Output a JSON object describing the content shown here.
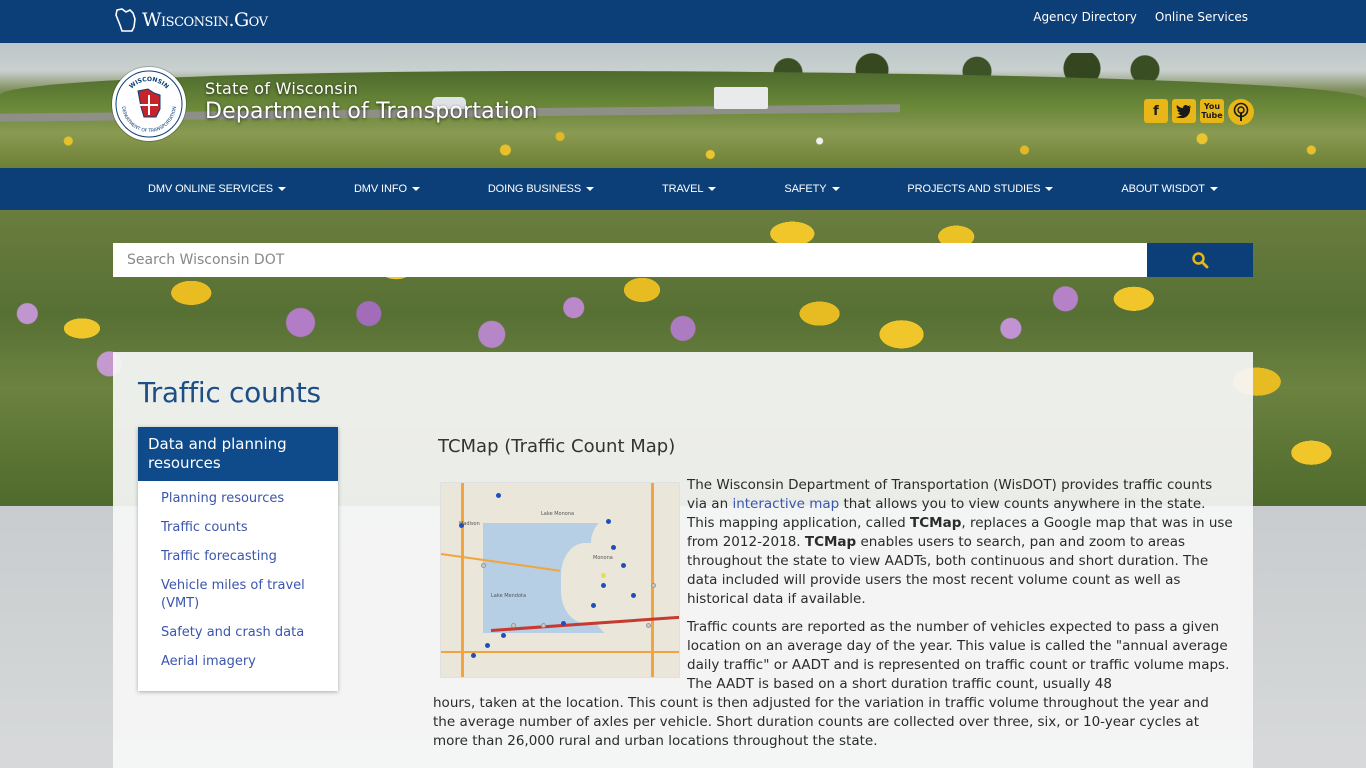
{
  "topbar": {
    "logo_text": "Wisconsin.Gov",
    "links": [
      "Agency Directory",
      "Online Services"
    ]
  },
  "header": {
    "seal_ring_top": "WISCONSIN",
    "seal_ring_bottom": "DEPARTMENT OF TRANSPORTATION",
    "state": "State of Wisconsin",
    "department": "Department of Transportation",
    "social": [
      "facebook-icon",
      "twitter-icon",
      "youtube-icon",
      "podcast-icon"
    ]
  },
  "nav": {
    "items": [
      "DMV ONLINE SERVICES",
      "DMV INFO",
      "DOING BUSINESS",
      "TRAVEL",
      "SAFETY",
      "PROJECTS AND STUDIES",
      "ABOUT WISDOT"
    ]
  },
  "search": {
    "placeholder": "Search Wisconsin DOT"
  },
  "main": {
    "title": "Traffic counts",
    "sidebar": {
      "heading": "Data and planning resources",
      "items": [
        "Planning resources",
        "Traffic counts",
        "Traffic forecasting",
        "Vehicle miles of travel (VMT)",
        "Safety and crash data",
        "Aerial imagery"
      ]
    },
    "section_title": "TCMap (Traffic Count Map)",
    "map_labels": [
      "Madison",
      "Lake Monona",
      "Monona",
      "Lake Mendota"
    ],
    "p1": {
      "a": "The Wisconsin Department of Transportation (WisDOT) provides traffic counts via an ",
      "link": "interactive map",
      "b": " that allows you to view counts anywhere in the state. This mapping application, called ",
      "bold1": "TCMap",
      "c": ", replaces a Google map that was in use from 2012-2018. ",
      "bold2": "TCMap",
      "d": " enables users to search, pan and zoom to areas throughout the state to view AADTs, both continuous and short duration. The data included will provide users the most recent volume count as well as historical data if available."
    },
    "p2": "Traffic counts are reported as the number of vehicles expected to pass a given location on an average day of the year. This value is called the \"annual average daily traffic\" or AADT and is represented on traffic count or traffic volume maps. The AADT is based on a short duration traffic count, usually 48",
    "p3": "hours, taken at the location. This count is then adjusted for the variation in traffic volume throughout the year and the average number of axles per vehicle. Short duration counts are collected over three, six, or 10-year cycles at more than 26,000 rural and urban locations throughout the state."
  },
  "colors": {
    "primary": "#0c3f78",
    "title": "#1d4f86",
    "link": "#3b56ad",
    "social": "#e8b617"
  }
}
